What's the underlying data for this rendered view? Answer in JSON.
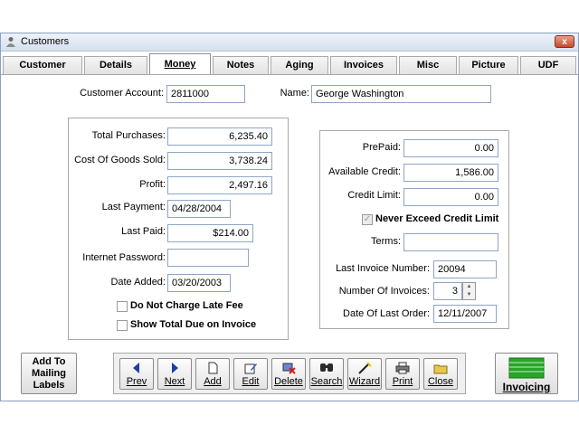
{
  "window": {
    "title": "Customers",
    "close_label": "x"
  },
  "tabs": [
    "Customer",
    "Details",
    "Money",
    "Notes",
    "Aging",
    "Invoices",
    "Misc",
    "Picture",
    "UDF"
  ],
  "active_tab": "Money",
  "header": {
    "account_label": "Customer Account:",
    "account_value": "2811000",
    "name_label": "Name:",
    "name_value": "George Washington"
  },
  "left_group": {
    "total_purchases_label": "Total Purchases:",
    "total_purchases": "6,235.40",
    "cogs_label": "Cost Of Goods Sold:",
    "cogs": "3,738.24",
    "profit_label": "Profit:",
    "profit": "2,497.16",
    "last_payment_label": "Last Payment:",
    "last_payment": "04/28/2004",
    "last_paid_label": "Last Paid:",
    "last_paid": "$214.00",
    "internet_password_label": "Internet Password:",
    "internet_password": "",
    "date_added_label": "Date Added:",
    "date_added": "03/20/2003",
    "late_fee_label": "Do Not Charge Late Fee",
    "show_total_label": "Show Total Due on Invoice"
  },
  "right_group": {
    "prepaid_label": "PrePaid:",
    "prepaid": "0.00",
    "available_credit_label": "Available Credit:",
    "available_credit": "1,586.00",
    "credit_limit_label": "Credit Limit:",
    "credit_limit": "0.00",
    "never_exceed_label": "Never Exceed Credit Limit",
    "terms_label": "Terms:",
    "terms": "",
    "last_invoice_number_label": "Last Invoice Number:",
    "last_invoice_number": "20094",
    "number_of_invoices_label": "Number Of Invoices:",
    "number_of_invoices": "3",
    "date_of_last_order_label": "Date Of Last Order:",
    "date_of_last_order": "12/11/2007"
  },
  "buttons": {
    "mailing": "Add To Mailing Labels",
    "prev": "Prev",
    "next": "Next",
    "add": "Add",
    "edit": "Edit",
    "delete": "Delete",
    "search": "Search",
    "wizard": "Wizard",
    "print": "Print",
    "close": "Close",
    "invoicing": "Invoicing"
  },
  "colors": {
    "accent_blue": "#1e3ea8",
    "invoicing_green": "#2aa52a"
  }
}
